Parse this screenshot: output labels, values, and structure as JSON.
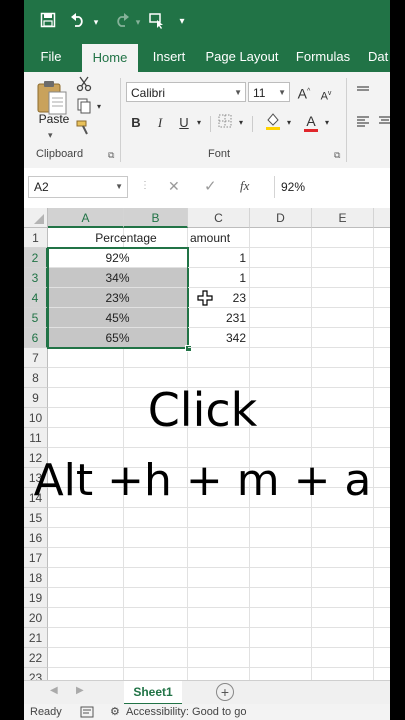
{
  "qat": {
    "save_icon": "save-icon",
    "undo_icon": "undo-icon",
    "redo_icon": "redo-icon",
    "touch_icon": "touch-mode-icon",
    "customize_icon": "customize-icon"
  },
  "tabs": [
    "File",
    "Home",
    "Insert",
    "Page Layout",
    "Formulas",
    "Dat"
  ],
  "ribbon": {
    "paste_label": "Paste",
    "clipboard_label": "Clipboard",
    "font_name": "Calibri",
    "font_size": "11",
    "grow_font": "A",
    "shrink_font": "A",
    "bold": "B",
    "italic": "I",
    "underline": "U",
    "font_color_letter": "A",
    "font_label": "Font"
  },
  "formula_bar": {
    "name_box": "A2",
    "cancel": "✕",
    "enter": "✓",
    "fx": "fx",
    "formula": "92%"
  },
  "columns": [
    "A",
    "B",
    "C",
    "D",
    "E"
  ],
  "rows": [
    "1",
    "2",
    "3",
    "4",
    "5",
    "6",
    "7",
    "8",
    "9",
    "10",
    "11",
    "12",
    "13",
    "14",
    "15",
    "16",
    "17",
    "18",
    "19",
    "20",
    "21",
    "22",
    "23"
  ],
  "cells": {
    "a1": "Percentage",
    "c1": "amount",
    "a2": "92%",
    "a3": "34%",
    "a4": "23%",
    "a5": "45%",
    "a6": "65%",
    "c2": "1",
    "c3": "1",
    "c4": "23",
    "c5": "231",
    "c6": "342"
  },
  "overlay": {
    "line1": "Click",
    "line2": "Alt +h + m + a"
  },
  "sheets": {
    "active": "Sheet1",
    "add": "+"
  },
  "status": {
    "ready": "Ready",
    "accessibility": "Accessibility: Good to go"
  },
  "colors": {
    "excel_green": "#217346",
    "selection_fill": "#c6c6c6"
  }
}
